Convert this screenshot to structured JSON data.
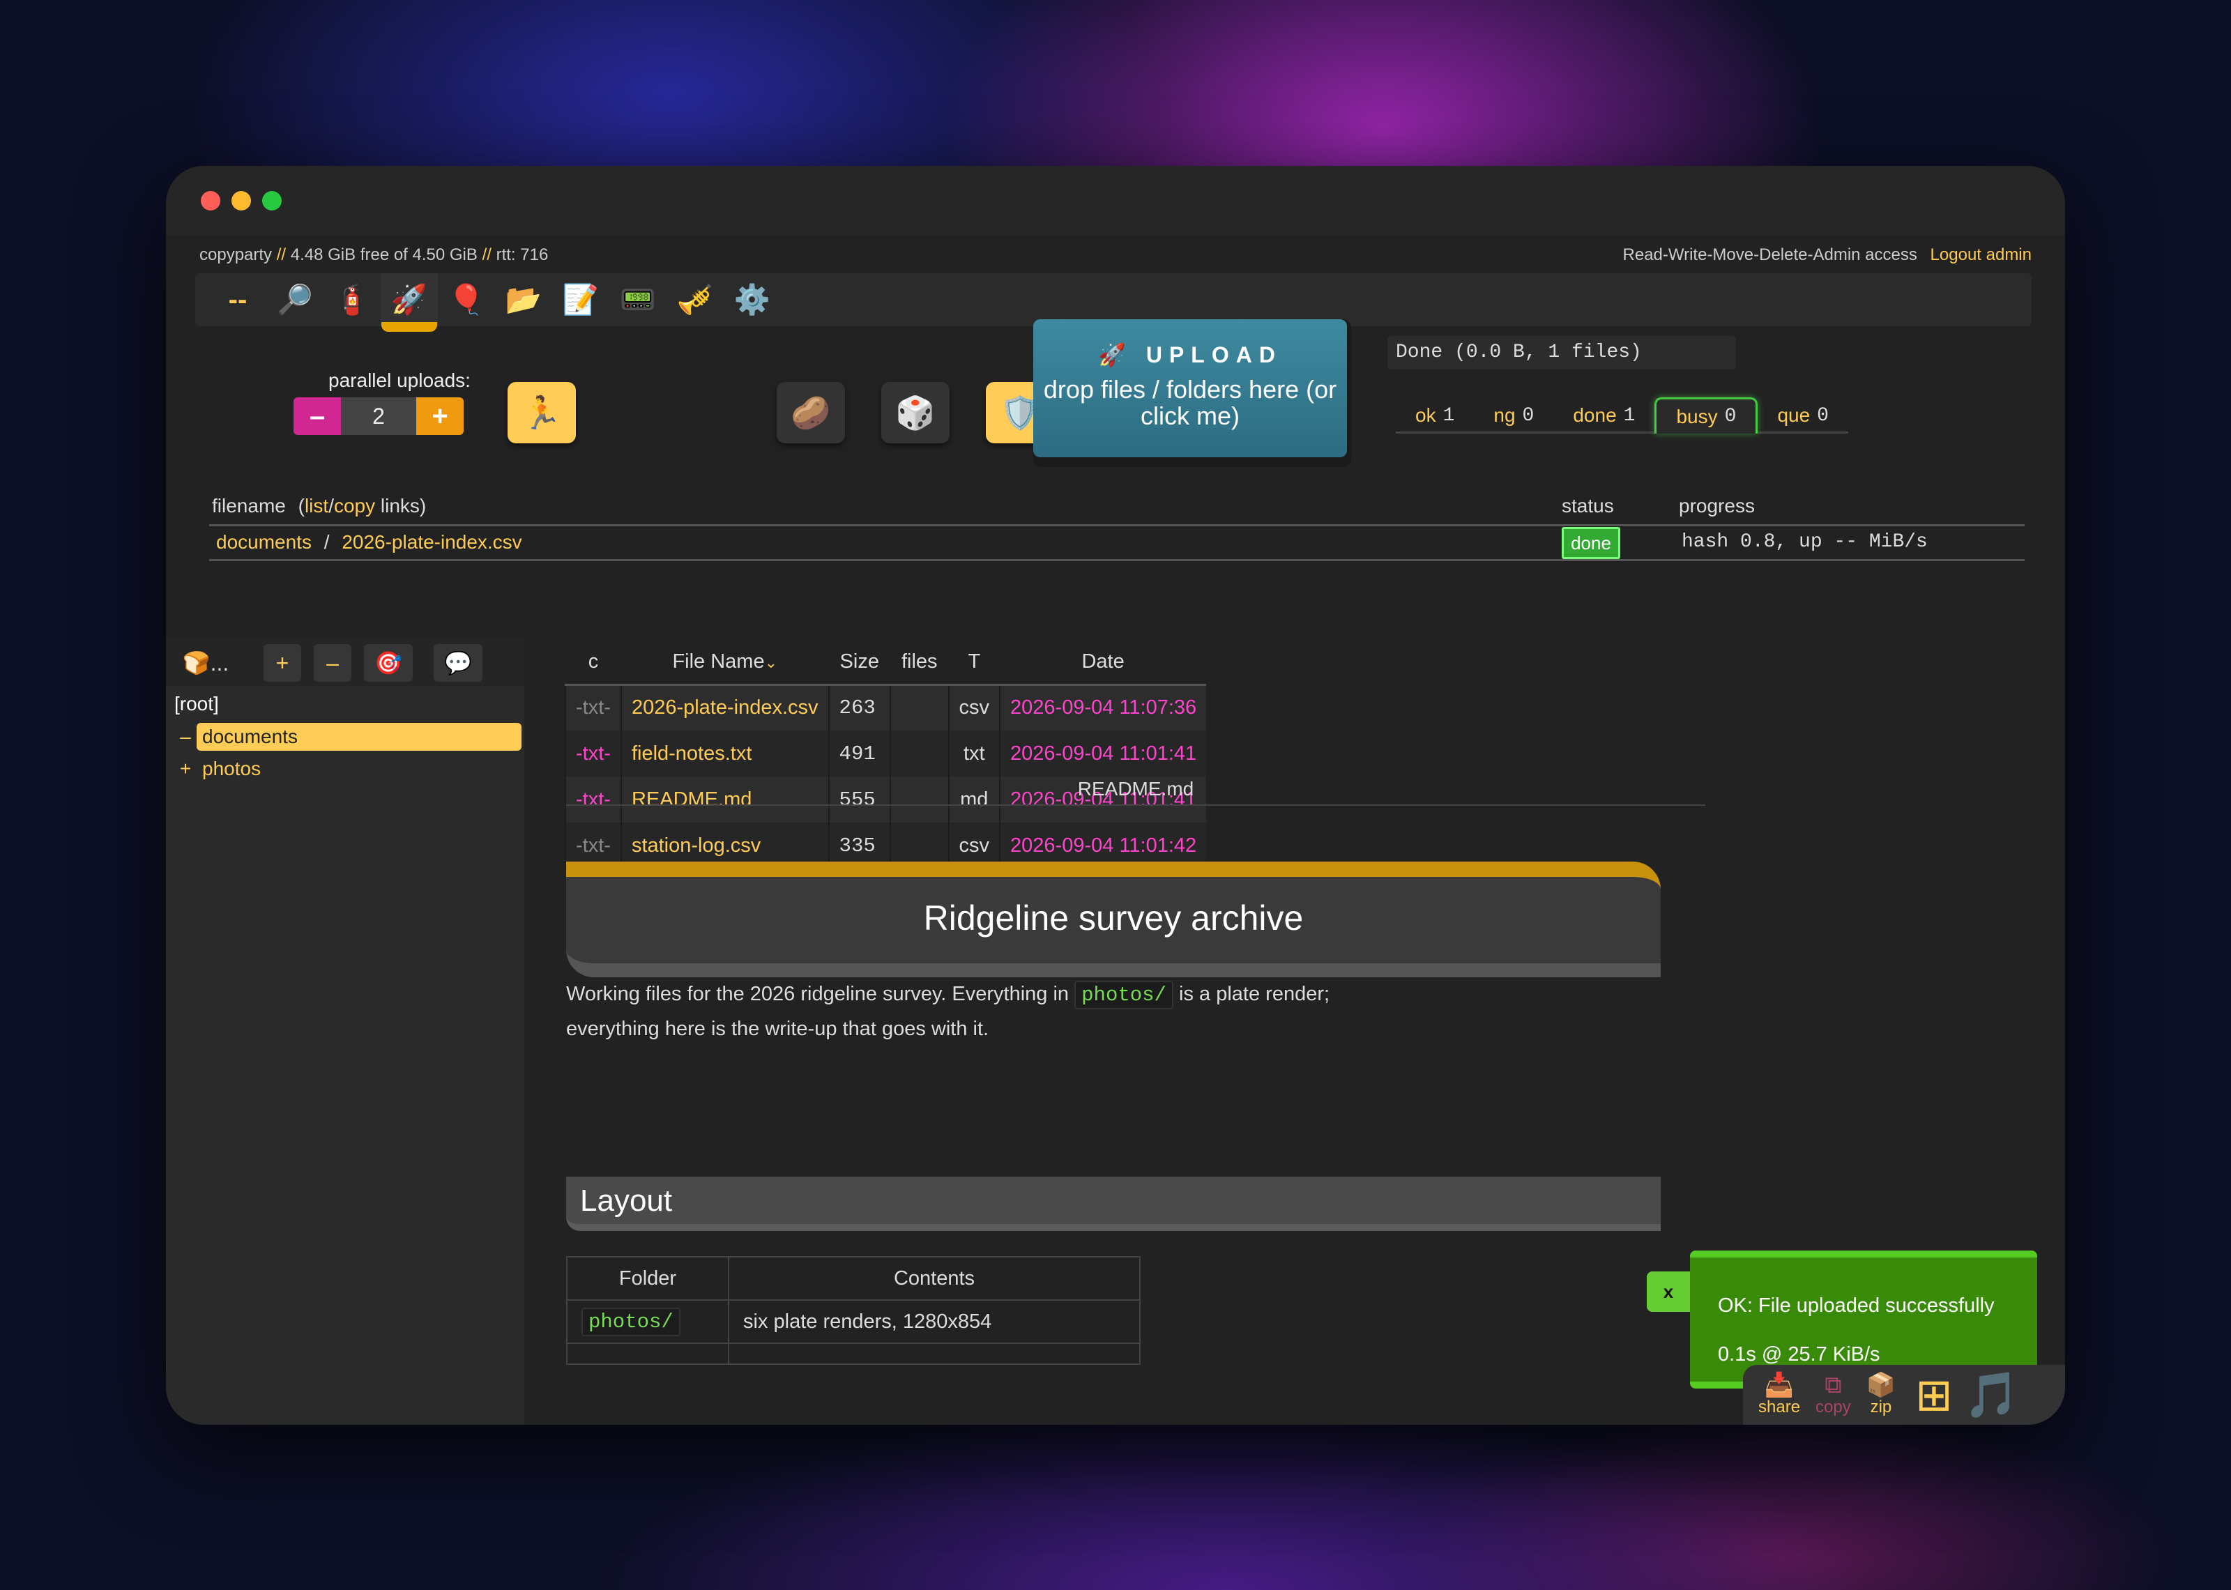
{
  "topbar": {
    "app": "copyparty",
    "sep": "//",
    "disk": "4.48 GiB free of 4.50 GiB",
    "rtt": "rtt: 716",
    "access": "Read-Write-Move-Delete-Admin access",
    "logout": "Logout admin"
  },
  "ops": [
    {
      "name": "collapse",
      "glyph": "--"
    },
    {
      "name": "search",
      "glyph": "🔎"
    },
    {
      "name": "unpost",
      "glyph": "🧯"
    },
    {
      "name": "upload",
      "glyph": "🚀"
    },
    {
      "name": "msg",
      "glyph": "🎈"
    },
    {
      "name": "mkdir",
      "glyph": "📂"
    },
    {
      "name": "new-doc",
      "glyph": "📝"
    },
    {
      "name": "terminal",
      "glyph": "📟"
    },
    {
      "name": "config",
      "glyph": "🎺"
    },
    {
      "name": "settings",
      "glyph": "⚙️"
    }
  ],
  "uploader": {
    "parallel_label": "parallel uploads:",
    "parallel_minus": "–",
    "parallel_value": "2",
    "parallel_plus": "+",
    "buttons": [
      "🏃",
      "🥔",
      "🎲",
      "🛡️",
      "🔎"
    ],
    "upload_title": "🚀 UPLOAD",
    "upload_sub": "drop files / folders here (or click me)",
    "done_summary": "Done (0.0 B, 1 files)"
  },
  "tabs": [
    {
      "label": "ok",
      "count": "1"
    },
    {
      "label": "ng",
      "count": "0"
    },
    {
      "label": "done",
      "count": "1"
    },
    {
      "label": "busy",
      "count": "0"
    },
    {
      "label": "que",
      "count": "0"
    }
  ],
  "upload_table": {
    "filename_label": "filename",
    "paren_open": "(",
    "list_link": "list",
    "slash": "/",
    "copy_link": "copy",
    "links_label": "links)",
    "status_label": "status",
    "progress_label": "progress",
    "row_dir": "documents",
    "row_sep": "/",
    "row_file": "2026-plate-index.csv",
    "row_status": "done",
    "row_progress": "hash 0.8, up -- MiB/s"
  },
  "tree": {
    "toolbar": [
      "🍞...",
      "+",
      "–",
      "🎯",
      "💬"
    ],
    "root": "[root]",
    "items": [
      {
        "pm": "–",
        "name": "documents"
      },
      {
        "pm": "+",
        "name": "photos"
      }
    ]
  },
  "files": {
    "headers": [
      "c",
      "File Name",
      "Size",
      "files",
      "T",
      "Date"
    ],
    "sort_mark": "⌄",
    "rows": [
      {
        "c": "-txt-",
        "name": "2026-plate-index.csv",
        "size": "263",
        "files": "",
        "t": "csv",
        "date": "2026-09-04 11:07:36"
      },
      {
        "c": "-txt-",
        "name": "field-notes.txt",
        "size": "491",
        "files": "",
        "t": "txt",
        "date": "2026-09-04 11:01:41"
      },
      {
        "c": "-txt-",
        "name": "README.md",
        "size": "555",
        "files": "",
        "t": "md",
        "date": "2026-09-04 11:01:41"
      },
      {
        "c": "-txt-",
        "name": "station-log.csv",
        "size": "335",
        "files": "",
        "t": "csv",
        "date": "2026-09-04 11:01:42"
      }
    ]
  },
  "readme": {
    "filename": "README.md",
    "h1": "Ridgeline survey archive",
    "para_a": "Working files for the 2026 ridgeline survey. Everything in",
    "para_code": "photos/",
    "para_b": "is a plate render; everything here is the write-up that goes with it.",
    "h2": "Layout",
    "table_headers": [
      "Folder",
      "Contents"
    ],
    "table_row_folder": "photos/",
    "table_row_contents": "six plate renders, 1280x854"
  },
  "toast": {
    "close": "x",
    "line1": "OK: File uploaded successfully",
    "line2": "0.1s @ 25.7 KiB/s"
  },
  "bottombar": {
    "share": "share",
    "copy": "copy",
    "zip": "zip",
    "grid_glyph": "⊞",
    "music_glyph": "🎵"
  }
}
